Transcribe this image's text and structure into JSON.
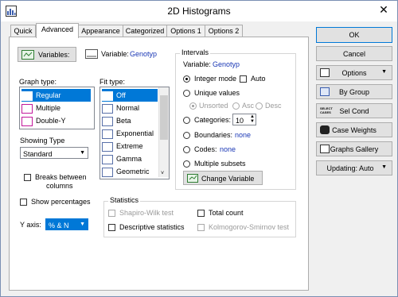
{
  "window": {
    "title": "2D Histograms",
    "close": "✕"
  },
  "tabs": [
    "Quick",
    "Advanced",
    "Appearance",
    "Categorized",
    "Options 1",
    "Options 2"
  ],
  "variables": {
    "button_label": "Variables:",
    "label": "Variable:",
    "value": "Genotyp"
  },
  "graph_type": {
    "label": "Graph type:",
    "items": [
      "Regular",
      "Multiple",
      "Double-Y"
    ],
    "selected": "Regular"
  },
  "fit_type": {
    "label": "Fit type:",
    "items": [
      "Off",
      "Normal",
      "Beta",
      "Exponential",
      "Extreme",
      "Gamma",
      "Geometric"
    ],
    "selected": "Off"
  },
  "showing_type": {
    "label": "Showing Type",
    "value": "Standard"
  },
  "breaks": {
    "label_line1": "Breaks between",
    "label_line2": "columns",
    "checked": false
  },
  "show_percentages": {
    "label": "Show percentages",
    "checked": false
  },
  "y_axis": {
    "label": "Y axis:",
    "value": "% & N"
  },
  "intervals": {
    "label": "Intervals",
    "variable_label": "Variable:",
    "variable_value": "Genotyp",
    "integer_mode": "Integer mode",
    "auto": "Auto",
    "unique_values": "Unique values",
    "unsorted": "Unsorted",
    "asc": "Asc",
    "desc": "Desc",
    "categories": "Categories:",
    "categories_value": "10",
    "boundaries": "Boundaries:",
    "boundaries_value": "none",
    "codes": "Codes:",
    "codes_value": "none",
    "multiple_subsets": "Multiple subsets",
    "change_variable": "Change Variable"
  },
  "statistics": {
    "label": "Statistics",
    "shapiro": "Shapiro-Wilk test",
    "total_count": "Total count",
    "descriptive": "Descriptive statistics",
    "kolmogorov": "Kolmogorov-Smirnov test"
  },
  "right_buttons": {
    "ok": "OK",
    "cancel": "Cancel",
    "options": "Options",
    "by_group": "By Group",
    "sel_cond": "Sel Cond",
    "case_weights": "Case Weights",
    "graphs_gallery": "Graphs Gallery",
    "updating": "Updating: Auto"
  },
  "icons": {
    "app": "app-icon",
    "variables": "variables-icon",
    "variable_swatch": "variable-swatch-icon"
  },
  "colors": {
    "selection": "#0078d7",
    "link_blue": "#1a37b5",
    "icon_magenta": "#c2189b",
    "icon_blue": "#3a5dae"
  }
}
